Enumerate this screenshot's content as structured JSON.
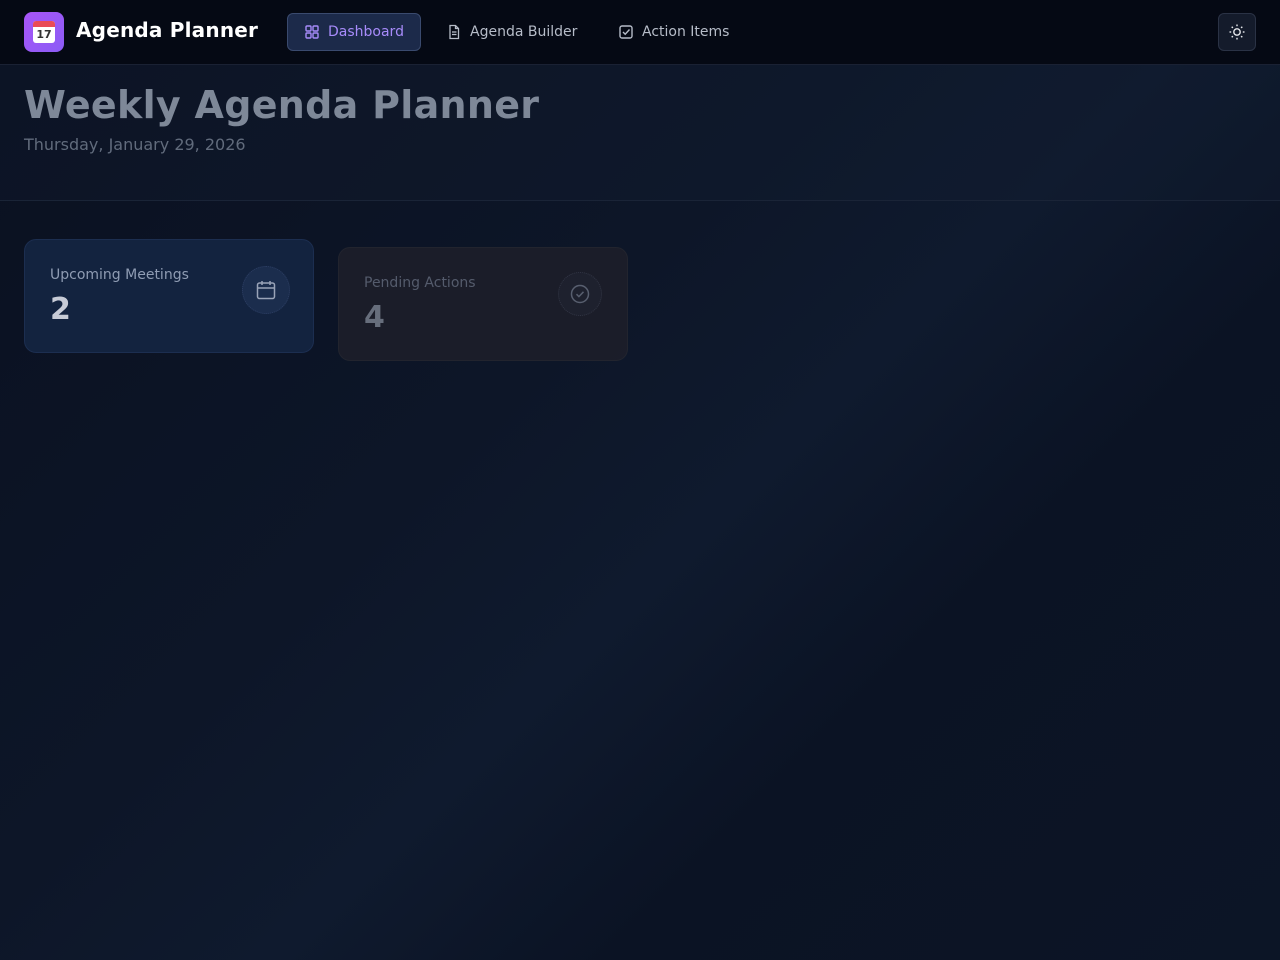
{
  "app": {
    "name": "Agenda Planner",
    "logo_day": "17"
  },
  "nav": {
    "items": [
      {
        "label": "Dashboard",
        "icon": "dashboard-icon",
        "active": true
      },
      {
        "label": "Agenda Builder",
        "icon": "document-icon",
        "active": false
      },
      {
        "label": "Action Items",
        "icon": "checkbox-icon",
        "active": false
      }
    ]
  },
  "theme_toggle": {
    "icon": "sun-icon"
  },
  "header": {
    "title": "Weekly Agenda Planner",
    "date": "Thursday, January 29, 2026"
  },
  "stats": [
    {
      "label": "Upcoming Meetings",
      "value": "2",
      "icon": "calendar-icon"
    },
    {
      "label": "Pending Actions",
      "value": "4",
      "icon": "check-circle-icon"
    }
  ],
  "colors": {
    "accent": "#a78bfa",
    "logo_gradient_start": "#a855f7",
    "logo_gradient_end": "#8b5cf6",
    "topbar_bg": "#050914"
  }
}
